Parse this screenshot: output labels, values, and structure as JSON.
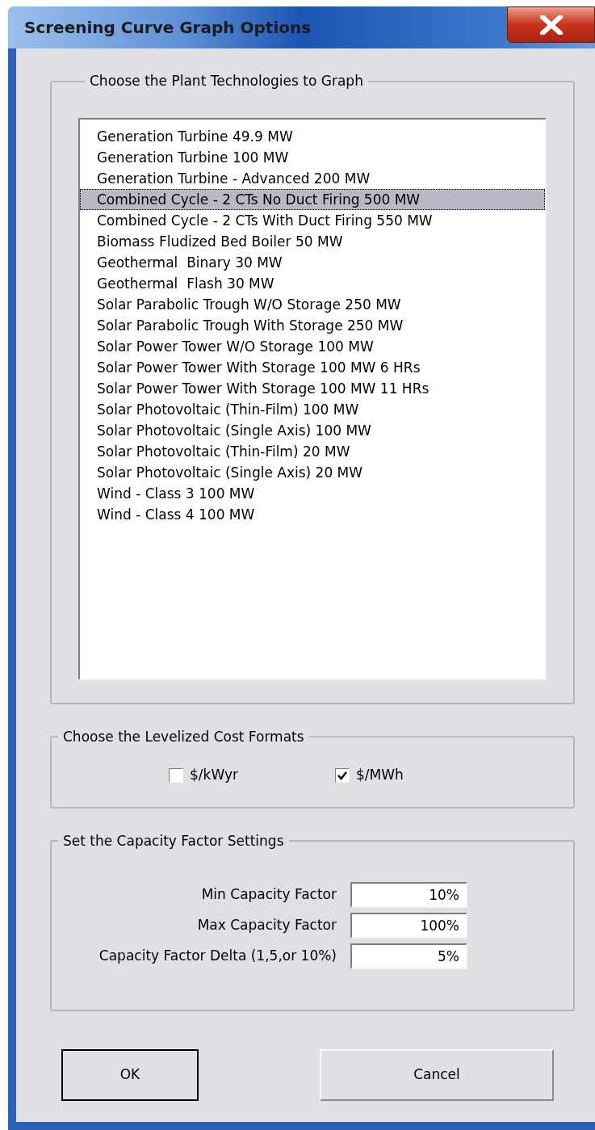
{
  "window": {
    "title": "Screening Curve Graph Options"
  },
  "technologies": {
    "title": "Choose the Plant Technologies to Graph",
    "items": [
      {
        "label": "Generation Turbine 49.9 MW",
        "selected": false
      },
      {
        "label": "Generation Turbine 100 MW",
        "selected": false
      },
      {
        "label": "Generation Turbine - Advanced 200 MW",
        "selected": false
      },
      {
        "label": "Combined Cycle - 2 CTs No Duct Firing 500 MW",
        "selected": true
      },
      {
        "label": "Combined Cycle - 2 CTs With Duct Firing 550 MW",
        "selected": false
      },
      {
        "label": "Biomass Fludized Bed Boiler 50 MW",
        "selected": false
      },
      {
        "label": "Geothermal  Binary 30 MW",
        "selected": false
      },
      {
        "label": "Geothermal  Flash 30 MW",
        "selected": false
      },
      {
        "label": "Solar Parabolic Trough W/O Storage 250 MW",
        "selected": false
      },
      {
        "label": "Solar Parabolic Trough With Storage 250 MW",
        "selected": false
      },
      {
        "label": "Solar Power Tower W/O Storage 100 MW",
        "selected": false
      },
      {
        "label": "Solar Power Tower With Storage 100 MW 6 HRs",
        "selected": false
      },
      {
        "label": "Solar Power Tower With Storage 100 MW 11 HRs",
        "selected": false
      },
      {
        "label": "Solar Photovoltaic (Thin-Film) 100 MW",
        "selected": false
      },
      {
        "label": "Solar Photovoltaic (Single Axis) 100 MW",
        "selected": false
      },
      {
        "label": "Solar Photovoltaic (Thin-Film) 20 MW",
        "selected": false
      },
      {
        "label": "Solar Photovoltaic (Single Axis) 20 MW",
        "selected": false
      },
      {
        "label": "Wind - Class 3 100 MW",
        "selected": false
      },
      {
        "label": "Wind - Class 4 100 MW",
        "selected": false
      }
    ]
  },
  "cost_formats": {
    "title": "Choose the Levelized Cost Formats",
    "options": [
      {
        "label": "$/kWyr",
        "checked": false
      },
      {
        "label": "$/MWh",
        "checked": true
      }
    ]
  },
  "capacity_factor": {
    "title": "Set the Capacity Factor Settings",
    "fields": [
      {
        "label": "Min Capacity Factor",
        "value": "10%"
      },
      {
        "label": "Max Capacity Factor",
        "value": "100%"
      },
      {
        "label": "Capacity Factor Delta (1,5,or 10%)",
        "value": "5%"
      }
    ]
  },
  "buttons": [
    {
      "label": "OK",
      "default": true
    },
    {
      "label": "Cancel",
      "default": false
    }
  ]
}
